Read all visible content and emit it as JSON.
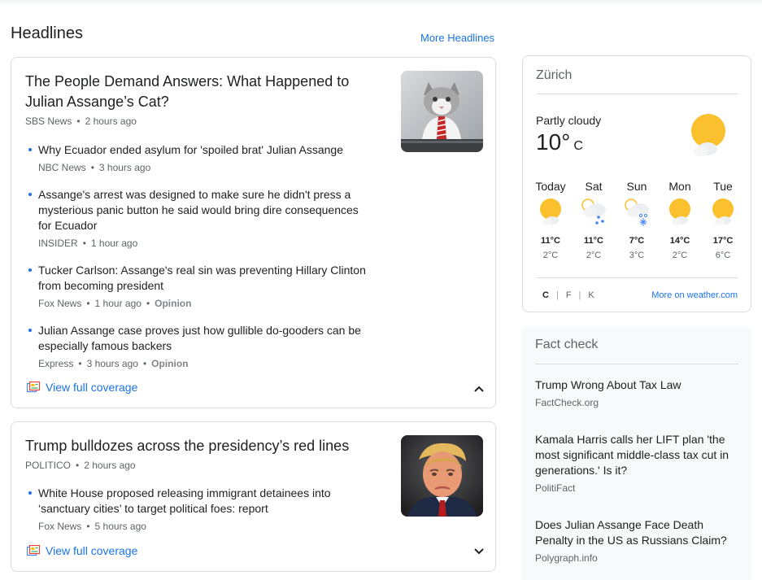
{
  "headlines": {
    "title": "Headlines",
    "more_label": "More Headlines"
  },
  "story1": {
    "title": "The People Demand Answers: What Happened to Julian Assange’s Cat?",
    "source": "SBS News",
    "time": "2 hours ago",
    "thumbnail": "cat-in-striped-tie-photo",
    "related": [
      {
        "title": "Why Ecuador ended asylum for 'spoiled brat' Julian Assange",
        "source": "NBC News",
        "time": "3 hours ago",
        "tag": ""
      },
      {
        "title": "Assange's arrest was designed to make sure he didn't press a mysterious panic button he said would bring dire consequences for Ecuador",
        "source": "INSIDER",
        "time": "1 hour ago",
        "tag": ""
      },
      {
        "title": "Tucker Carlson: Assange's real sin was preventing Hillary Clinton from becoming president",
        "source": "Fox News",
        "time": "1 hour ago",
        "tag": "Opinion"
      },
      {
        "title": "Julian Assange case proves just how gullible do-gooders can be especially famous backers",
        "source": "Express",
        "time": "3 hours ago",
        "tag": "Opinion"
      }
    ],
    "coverage_label": "View full coverage",
    "expanded": true
  },
  "story2": {
    "title": "Trump bulldozes across the presidency’s red lines",
    "source": "POLITICO",
    "time": "2 hours ago",
    "thumbnail": "donald-trump-portrait-photo",
    "related": [
      {
        "title": "White House proposed releasing immigrant detainees into ‘sanctuary cities’ to target political foes: report",
        "source": "Fox News",
        "time": "5 hours ago",
        "tag": ""
      }
    ],
    "coverage_label": "View full coverage",
    "expanded": false
  },
  "weather": {
    "city": "Zürich",
    "condition": "Partly cloudy",
    "temp": "10°",
    "unit": "C",
    "current_icon": "partly-cloudy-icon",
    "forecast": [
      {
        "day": "Today",
        "hi": "11°C",
        "lo": "2°C",
        "icon": "partly-cloudy-icon"
      },
      {
        "day": "Sat",
        "hi": "11°C",
        "lo": "2°C",
        "icon": "rain-icon"
      },
      {
        "day": "Sun",
        "hi": "7°C",
        "lo": "3°C",
        "icon": "rain-snow-icon"
      },
      {
        "day": "Mon",
        "hi": "14°C",
        "lo": "2°C",
        "icon": "partly-cloudy-icon"
      },
      {
        "day": "Tue",
        "hi": "17°C",
        "lo": "6°C",
        "icon": "partly-cloudy-icon"
      }
    ],
    "units": [
      "C",
      "F",
      "K"
    ],
    "selected_unit": "C",
    "more_label": "More on weather.com"
  },
  "fact_check": {
    "title": "Fact check",
    "items": [
      {
        "title": "Trump Wrong About Tax Law",
        "source": "FactCheck.org"
      },
      {
        "title": "Kamala Harris calls her LIFT plan 'the most significant middle-class tax cut in generations.' Is it?",
        "source": "PolitiFact"
      },
      {
        "title": "Does Julian Assange Face Death Penalty in the US as Russians Claim?",
        "source": "Polygraph.info"
      }
    ]
  },
  "colors": {
    "link": "#1a73e8",
    "sun": "#fbc02d",
    "cloud": "#eceff1",
    "rain": "#4285f4"
  }
}
